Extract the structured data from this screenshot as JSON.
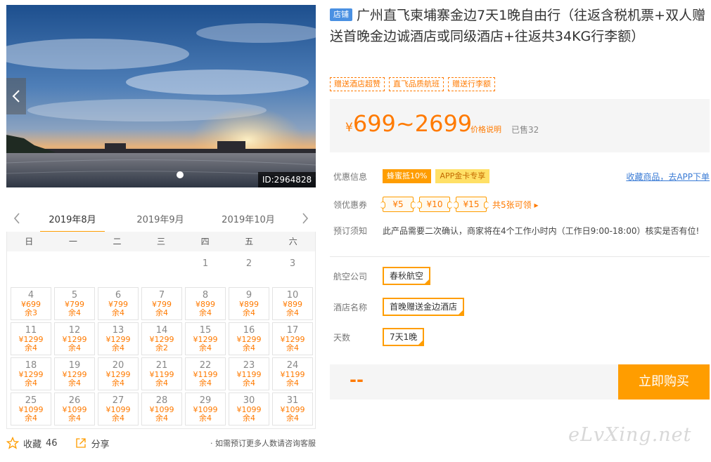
{
  "gallery": {
    "photo_id": "ID:2964828",
    "prev_icon": "chevron-left-icon",
    "next_icon": "chevron-right-icon"
  },
  "calendar": {
    "months": [
      "2019年8月",
      "2019年9月",
      "2019年10月"
    ],
    "active_month": 0,
    "weekdays": [
      "日",
      "一",
      "二",
      "三",
      "四",
      "五",
      "六"
    ],
    "empty_days": [
      "1",
      "2",
      "3"
    ],
    "days": [
      {
        "d": "4",
        "p": "¥699",
        "r": "余3"
      },
      {
        "d": "5",
        "p": "¥799",
        "r": "余4"
      },
      {
        "d": "6",
        "p": "¥799",
        "r": "余4"
      },
      {
        "d": "7",
        "p": "¥799",
        "r": "余4"
      },
      {
        "d": "8",
        "p": "¥899",
        "r": "余4"
      },
      {
        "d": "9",
        "p": "¥899",
        "r": "余4"
      },
      {
        "d": "10",
        "p": "¥899",
        "r": "余4"
      },
      {
        "d": "11",
        "p": "¥1299",
        "r": "余4"
      },
      {
        "d": "12",
        "p": "¥1299",
        "r": "余4"
      },
      {
        "d": "13",
        "p": "¥1299",
        "r": "余4"
      },
      {
        "d": "14",
        "p": "¥1299",
        "r": "余2"
      },
      {
        "d": "15",
        "p": "¥1299",
        "r": "余4"
      },
      {
        "d": "16",
        "p": "¥1299",
        "r": "余4"
      },
      {
        "d": "17",
        "p": "¥1299",
        "r": "余4"
      },
      {
        "d": "18",
        "p": "¥1299",
        "r": "余4"
      },
      {
        "d": "19",
        "p": "¥1299",
        "r": "余4"
      },
      {
        "d": "20",
        "p": "¥1299",
        "r": "余4"
      },
      {
        "d": "21",
        "p": "¥1199",
        "r": "余4"
      },
      {
        "d": "22",
        "p": "¥1199",
        "r": "余4"
      },
      {
        "d": "23",
        "p": "¥1199",
        "r": "余4"
      },
      {
        "d": "24",
        "p": "¥1199",
        "r": "余4"
      },
      {
        "d": "25",
        "p": "¥1099",
        "r": "余4"
      },
      {
        "d": "26",
        "p": "¥1099",
        "r": "余4"
      },
      {
        "d": "27",
        "p": "¥1099",
        "r": "余4"
      },
      {
        "d": "28",
        "p": "¥1099",
        "r": "余4"
      },
      {
        "d": "29",
        "p": "¥1099",
        "r": "余4"
      },
      {
        "d": "30",
        "p": "¥1099",
        "r": "余4"
      },
      {
        "d": "31",
        "p": "¥1099",
        "r": "余4"
      }
    ]
  },
  "bottom": {
    "favorite_label": "收藏",
    "favorite_count": "46",
    "share_label": "分享",
    "note": "· 如需预订更多人数请咨询客服"
  },
  "product": {
    "shop_badge": "店铺",
    "title": "广州直飞柬埔寨金边7天1晚自由行（往返含税机票+双人赠送首晚金边诚酒店或同级酒店+往返共34KG行李额）",
    "tags": [
      "赠送酒店超赞",
      "直飞品质航班",
      "赠送行李额"
    ],
    "price_currency": "¥",
    "price_range": "699~2699",
    "price_note": "价格说明",
    "sold": "已售32"
  },
  "offers": {
    "label": "优惠信息",
    "pill1": "蜂蜜抵10%",
    "pill2": "APP金卡专享",
    "fav_link": "收藏商品，去APP下单"
  },
  "coupons": {
    "label": "领优惠券",
    "items": [
      "¥5",
      "¥10",
      "¥15"
    ],
    "more": "共5张可领 ▸"
  },
  "notice": {
    "label": "预订须知",
    "text": "此产品需要二次确认，商家将在4个工作小时内（工作日9:00-18:00）核实是否有位!"
  },
  "options": {
    "airline_label": "航空公司",
    "airline_value": "春秋航空",
    "hotel_label": "酒店名称",
    "hotel_value": "首晚赠送金边酒店",
    "days_label": "天数",
    "days_value": "7天1晚"
  },
  "buy": {
    "total": "--",
    "button": "立即购买"
  },
  "watermark": "eLvXing.net",
  "colors": {
    "accent": "#ff9d00",
    "price": "#ff7a00",
    "link": "#3a7bd5"
  }
}
